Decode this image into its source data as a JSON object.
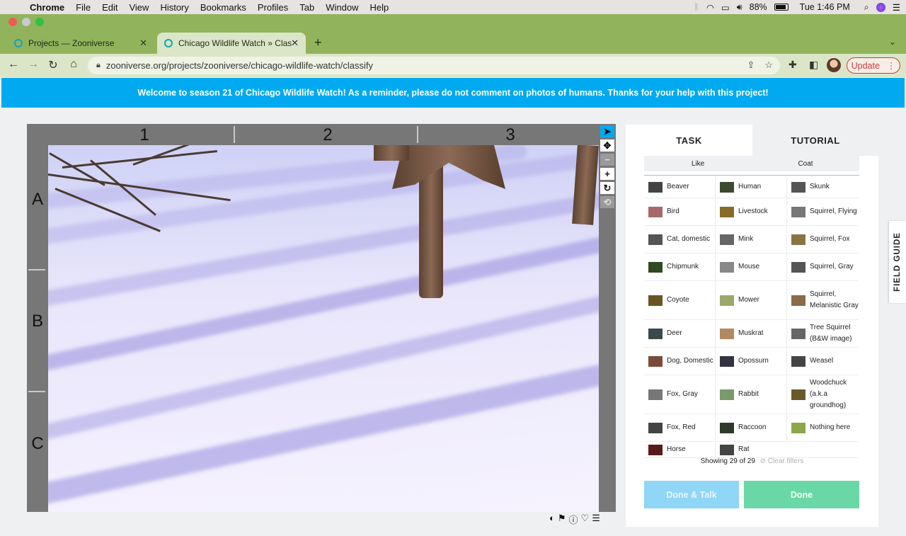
{
  "menubar": {
    "app": "Chrome",
    "items": [
      "File",
      "Edit",
      "View",
      "History",
      "Bookmarks",
      "Profiles",
      "Tab",
      "Window",
      "Help"
    ],
    "battery": "88%",
    "clock": "Tue 1:46 PM"
  },
  "tabs": [
    {
      "title": "Projects — Zooniverse"
    },
    {
      "title": "Chicago Wildlife Watch » Class"
    }
  ],
  "address": {
    "url": "zooniverse.org/projects/zooniverse/chicago-wildlife-watch/classify"
  },
  "update_label": "Update",
  "banner_text": "Welcome to season 21 of Chicago Wildlife Watch! As a reminder, please do not comment on photos of humans. Thanks for your help with this project!",
  "grid": {
    "columns": [
      "1",
      "2",
      "3"
    ],
    "rows": [
      "A",
      "B",
      "C"
    ]
  },
  "panel": {
    "task_tab": "TASK",
    "tutorial_tab": "TUTORIAL",
    "filters": {
      "like": "Like",
      "coat": "Coat"
    },
    "choices": [
      [
        "Beaver",
        "Human",
        "Skunk"
      ],
      [
        "Bird",
        "Livestock",
        "Squirrel, Flying"
      ],
      [
        "Cat, domestic",
        "Mink",
        "Squirrel, Fox"
      ],
      [
        "Chipmunk",
        "Mouse",
        "Squirrel, Gray"
      ],
      [
        "Coyote",
        "Mower",
        "Squirrel, Melanistic Gray"
      ],
      [
        "Deer",
        "Muskrat",
        "Tree Squirrel (B&W image)"
      ],
      [
        "Dog, Domestic",
        "Opossum",
        "Weasel"
      ],
      [
        "Fox, Gray",
        "Rabbit",
        "Woodchuck (a.k.a groundhog)"
      ],
      [
        "Fox, Red",
        "Raccoon",
        "Nothing here"
      ],
      [
        "Horse",
        "Rat"
      ]
    ],
    "thumb_colors": [
      [
        "#444",
        "#3b4a2e",
        "#555"
      ],
      [
        "#a86868",
        "#8a6a2a",
        "#777"
      ],
      [
        "#555",
        "#666",
        "#8a7444"
      ],
      [
        "#2f4a1f",
        "#888",
        "#555"
      ],
      [
        "#6a5424",
        "#9aa86a",
        "#8a6a4a"
      ],
      [
        "#3a4a4a",
        "#b08a60",
        "#666"
      ],
      [
        "#7a4a3a",
        "#334",
        "#444"
      ],
      [
        "#777",
        "#7a9a6a",
        "#6a5a2a"
      ],
      [
        "#444",
        "#2e3a2a",
        "#8aa84a"
      ],
      [
        "#5a1a1a",
        "#444"
      ]
    ],
    "showing": "Showing 29 of 29",
    "clear_filters": "Clear filters",
    "done_talk": "Done & Talk",
    "done": "Done"
  },
  "field_guide": "FIELD GUIDE"
}
